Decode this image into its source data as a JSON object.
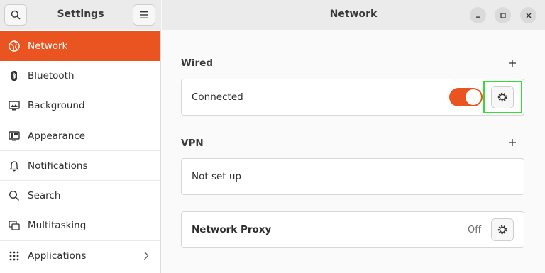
{
  "sidebar": {
    "title": "Settings",
    "items": [
      {
        "label": "Network",
        "icon": "network-globe-icon",
        "active": true
      },
      {
        "label": "Bluetooth",
        "icon": "bluetooth-icon"
      },
      {
        "label": "Background",
        "icon": "background-icon"
      },
      {
        "label": "Appearance",
        "icon": "appearance-icon"
      },
      {
        "label": "Notifications",
        "icon": "bell-icon"
      },
      {
        "label": "Search",
        "icon": "search-icon"
      },
      {
        "label": "Multitasking",
        "icon": "multitasking-icon"
      },
      {
        "label": "Applications",
        "icon": "grid-dots-icon"
      }
    ]
  },
  "header": {
    "title": "Network"
  },
  "wired": {
    "title": "Wired",
    "status": "Connected",
    "toggle_on": true
  },
  "vpn": {
    "title": "VPN",
    "status": "Not set up"
  },
  "proxy": {
    "label": "Network Proxy",
    "value": "Off"
  },
  "colors": {
    "accent": "#e95420",
    "highlight": "#33dd33"
  }
}
